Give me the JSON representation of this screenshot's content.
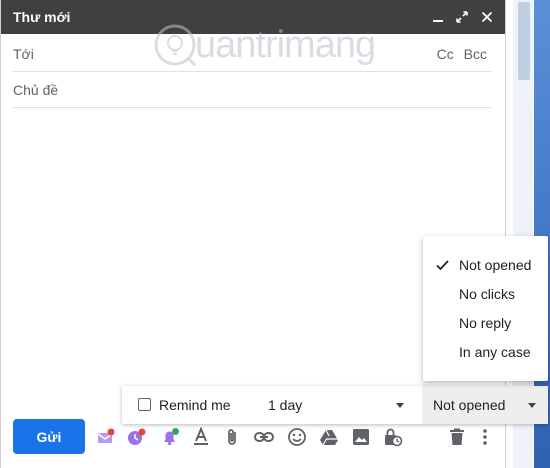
{
  "compose": {
    "title": "Thư mới",
    "to_label": "Tới",
    "cc_label": "Cc",
    "bcc_label": "Bcc",
    "subject_placeholder": "Chủ đề",
    "send_label": "Gửi"
  },
  "watermark": {
    "text": "uantrimang"
  },
  "reminder": {
    "checkbox_label": "Remind me",
    "checked": false,
    "delay_value": "1 day",
    "condition_value": "Not opened"
  },
  "condition_menu": {
    "items": [
      {
        "label": "Not opened",
        "selected": true
      },
      {
        "label": "No clicks",
        "selected": false
      },
      {
        "label": "No reply",
        "selected": false
      },
      {
        "label": "In any case",
        "selected": false
      }
    ]
  },
  "toolbar_icons": [
    "schedule-send-icon",
    "snooze-alarm-icon",
    "reminder-bell-icon",
    "text-format-icon",
    "attach-icon",
    "link-icon",
    "emoji-icon",
    "drive-icon",
    "photo-icon",
    "confidential-mode-icon",
    "delete-icon",
    "more-options-icon"
  ],
  "colors": {
    "titlebar": "#404040",
    "send_button": "#1a73e8",
    "icon_gray": "#5f6368",
    "addon_purple": "#9b73e6",
    "badge_red": "#ea4335",
    "badge_green": "#34a853"
  }
}
